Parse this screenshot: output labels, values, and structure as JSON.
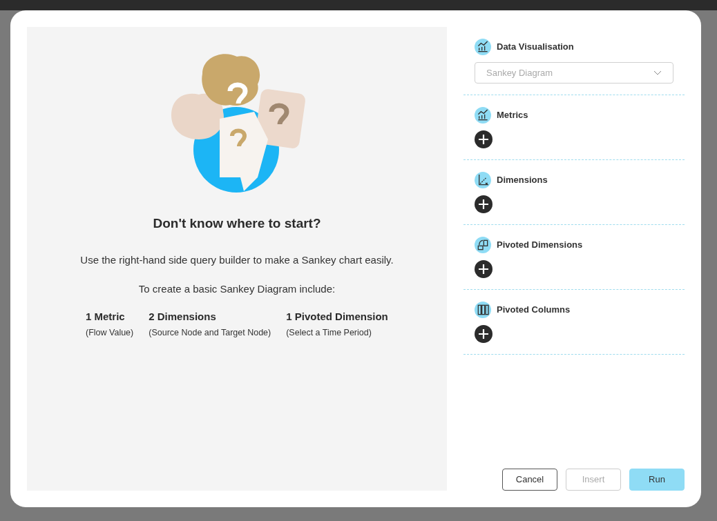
{
  "intro": {
    "heading": "Don't know where to start?",
    "lead": "Use the right-hand side query builder to make a Sankey chart easily.",
    "instruction": "To create a basic Sankey Diagram include:",
    "requirements": [
      {
        "title": "1 Metric",
        "detail": "(Flow Value)"
      },
      {
        "title": "2 Dimensions",
        "detail": "(Source Node and Target Node)"
      },
      {
        "title": "1 Pivoted Dimension",
        "detail": "(Select a Time Period)"
      }
    ]
  },
  "sections": [
    {
      "kind": "select",
      "label": "Data Visualisation",
      "value": "Sankey Diagram"
    },
    {
      "kind": "add",
      "label": "Metrics"
    },
    {
      "kind": "add",
      "label": "Dimensions"
    },
    {
      "kind": "add",
      "label": "Pivoted Dimensions"
    },
    {
      "kind": "add",
      "label": "Pivoted Columns"
    }
  ],
  "buttons": [
    {
      "label": "Cancel",
      "kind": "outline",
      "disabled": false
    },
    {
      "label": "Insert",
      "kind": "outline",
      "disabled": true
    },
    {
      "label": "Run",
      "kind": "primary",
      "disabled": false
    }
  ]
}
